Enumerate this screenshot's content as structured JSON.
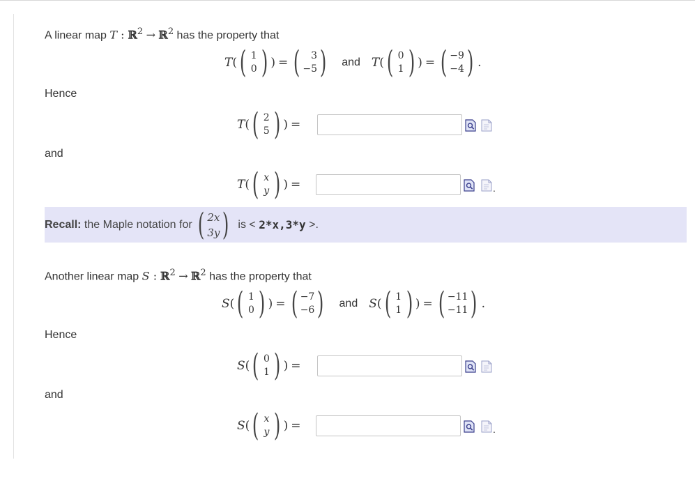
{
  "part1": {
    "intro_text": "A linear map",
    "map_name": "T",
    "map_domain": "ℝ",
    "map_power": "2",
    "map_arrow": "→",
    "map_codomain": "ℝ",
    "property_text": "has the property that",
    "given1": {
      "input": [
        "1",
        "0"
      ],
      "output": [
        "3",
        "−5"
      ]
    },
    "and_word": "and",
    "given2": {
      "input": [
        "0",
        "1"
      ],
      "output": [
        "−9",
        "−4"
      ]
    },
    "hence_label": "Hence",
    "q1_input": [
      "2",
      "5"
    ],
    "q1_value": "",
    "and_label": "and",
    "q2_input": [
      "x",
      "y"
    ],
    "q2_value": ""
  },
  "recall": {
    "bold": "Recall:",
    "text": "the Maple notation for",
    "vector": [
      "2x",
      "3y"
    ],
    "is_text": "is",
    "lt": "<",
    "code": "2*x,3*y",
    "gt": ">."
  },
  "part2": {
    "intro_text": "Another linear map",
    "map_name": "S",
    "map_domain": "ℝ",
    "map_power": "2",
    "map_arrow": "→",
    "map_codomain": "ℝ",
    "property_text": "has the property that",
    "given1": {
      "input": [
        "1",
        "0"
      ],
      "output": [
        "−7",
        "−6"
      ]
    },
    "and_word": "and",
    "given2": {
      "input": [
        "1",
        "1"
      ],
      "output": [
        "−11",
        "−11"
      ]
    },
    "hence_label": "Hence",
    "q1_input": [
      "0",
      "1"
    ],
    "q1_value": "",
    "and_label": "and",
    "q2_input": [
      "x",
      "y"
    ],
    "q2_value": ""
  },
  "icons": {
    "preview": "preview-icon",
    "help": "help-document-icon"
  },
  "colors": {
    "recall_bg": "#e4e4f7",
    "input_border": "#c4c4c4"
  }
}
